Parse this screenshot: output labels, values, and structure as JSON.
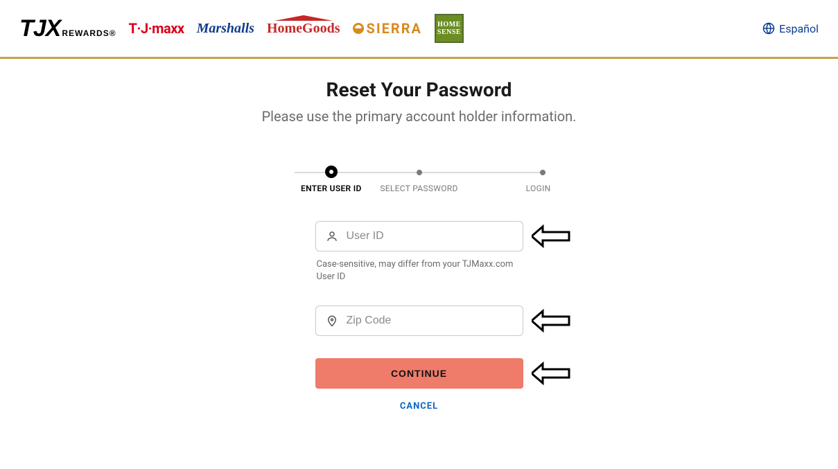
{
  "header": {
    "brands": {
      "tjx_big": "TJX",
      "tjx_small": "REWARDS®",
      "tjmaxx": "T·J·maxx",
      "marshalls": "Marshalls",
      "homegoods": "HomeGoods",
      "sierra": "SIERRA",
      "homesense_top": "HOME",
      "homesense_bottom": "SENSE"
    },
    "language_label": "Español"
  },
  "page": {
    "title": "Reset Your Password",
    "subtitle": "Please use the primary account holder information."
  },
  "stepper": {
    "step1": "ENTER USER ID",
    "step2": "SELECT PASSWORD",
    "step3": "LOGIN"
  },
  "form": {
    "user_id": {
      "placeholder": "User ID",
      "value": "",
      "hint": "Case-sensitive, may differ from your TJMaxx.com User ID"
    },
    "zip": {
      "placeholder": "Zip Code",
      "value": ""
    },
    "continue_label": "CONTINUE",
    "cancel_label": "CANCEL"
  }
}
